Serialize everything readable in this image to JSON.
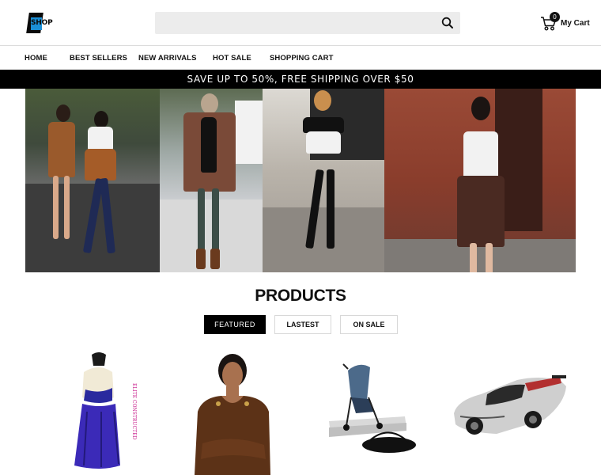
{
  "header": {
    "logo_text": "SHOP",
    "search": {
      "placeholder": "",
      "value": ""
    },
    "cart": {
      "count": "0",
      "label": "My Cart"
    }
  },
  "nav": {
    "items": [
      {
        "label": "HOME"
      },
      {
        "label": "BEST SELLERS"
      },
      {
        "label": "NEW ARRIVALS"
      },
      {
        "label": "HOT SALE"
      },
      {
        "label": "SHOPPING CART"
      }
    ]
  },
  "promo": {
    "text": "SAVE UP TO 50%, FREE SHIPPING OVER $50"
  },
  "products": {
    "title": "PRODUCTS",
    "tabs": [
      {
        "label": "FEATURED",
        "active": true
      },
      {
        "label": "LASTEST",
        "active": false
      },
      {
        "label": "ON SALE",
        "active": false
      }
    ],
    "items": [
      {
        "image": "purple-dance-costume",
        "side_text": "ELITE CONSTRUCTED"
      },
      {
        "image": "woman-brown-blouse"
      },
      {
        "image": "blue-baby-stroller"
      },
      {
        "image": "white-toy-supercar"
      }
    ]
  },
  "colors": {
    "accent": "#000000",
    "logo_blue": "#1b8fd6",
    "search_bg": "#ececec"
  }
}
